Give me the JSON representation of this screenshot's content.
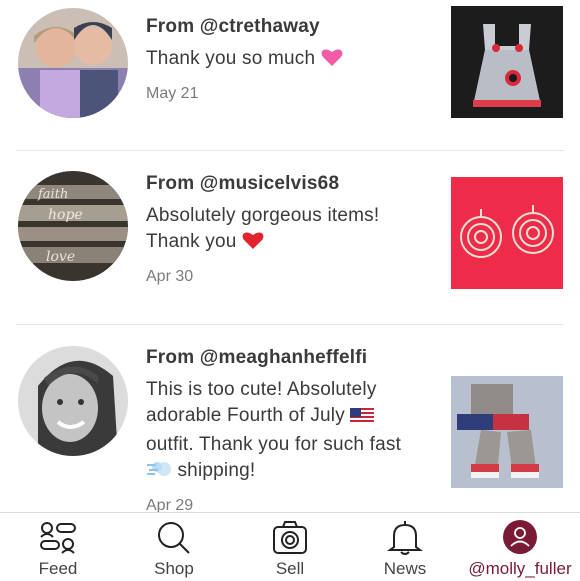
{
  "feed": {
    "items": [
      {
        "from": "From @ctrethaway",
        "message": "Thank you so much",
        "message_emoji": "pink-heart",
        "date": "May 21"
      },
      {
        "from": "From @musicelvis68",
        "message_line1": "Absolutely gorgeous items!",
        "message_line2": "Thank you",
        "message_emoji": "red-heart",
        "date": "Apr 30"
      },
      {
        "from": "From @meaghanheffelfi",
        "message_line1": "This is too cute! Absolutely",
        "message_line2": "adorable Fourth of July",
        "message_line3": "outfit. Thank you for such fast",
        "message_line4": "shipping!",
        "message_emojis": [
          "us-flag",
          "dash"
        ],
        "date": "Apr 29"
      }
    ]
  },
  "tabbar": {
    "tabs": [
      {
        "label": "Feed",
        "icon": "feed-icon"
      },
      {
        "label": "Shop",
        "icon": "search-icon"
      },
      {
        "label": "Sell",
        "icon": "camera-icon"
      },
      {
        "label": "News",
        "icon": "bell-icon"
      },
      {
        "label": "@molly_fuller",
        "icon": "profile-icon"
      }
    ],
    "active_color": "#7a1a35"
  }
}
